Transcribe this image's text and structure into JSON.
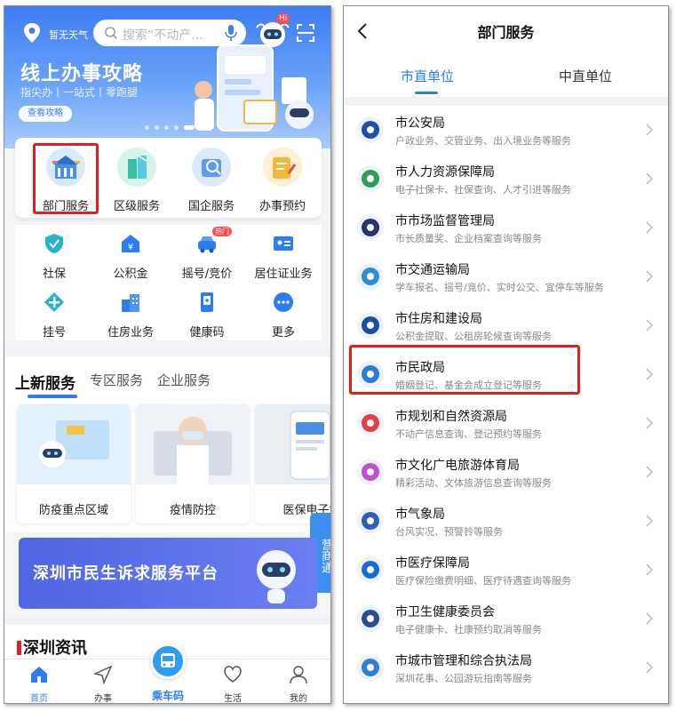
{
  "left": {
    "topbar": {
      "weather": "暂无天气",
      "search_placeholder": "搜索“不动产...",
      "robot_badge": "Hi"
    },
    "banner": {
      "title": "线上办事攻略",
      "subtitle": "指尖办丨一站式丨零跑腿",
      "button": "查看攻略"
    },
    "main_services": [
      {
        "label": "部门服务",
        "icon": "department-icon",
        "color": "#4a90e2"
      },
      {
        "label": "区级服务",
        "icon": "district-icon",
        "color": "#3bbfa6"
      },
      {
        "label": "国企服务",
        "icon": "soe-icon",
        "color": "#5b9cf0"
      },
      {
        "label": "办事预约",
        "icon": "appointment-icon",
        "color": "#f5b63c"
      }
    ],
    "grid": [
      {
        "label": "社保",
        "icon": "shield-icon"
      },
      {
        "label": "公积金",
        "icon": "fund-icon"
      },
      {
        "label": "摇号/竞价",
        "icon": "car-icon",
        "badge": "热门"
      },
      {
        "label": "居住证业务",
        "icon": "id-card-icon"
      },
      {
        "label": "挂号",
        "icon": "plus-icon"
      },
      {
        "label": "住房业务",
        "icon": "building-icon"
      },
      {
        "label": "健康码",
        "icon": "phone-icon"
      },
      {
        "label": "更多",
        "icon": "more-icon"
      }
    ],
    "tabs": [
      "上新服务",
      "专区服务",
      "企业服务"
    ],
    "tiles": [
      "防疫重点区域",
      "疫情防控",
      "医保电子凭"
    ],
    "side_tab": "营商通",
    "promo": "深圳市民生诉求服务平台",
    "news_title": "深圳资讯",
    "nav": [
      "首页",
      "办事",
      "乘车码",
      "生活",
      "我的"
    ]
  },
  "right": {
    "title": "部门服务",
    "tabs": [
      "市直单位",
      "中直单位"
    ],
    "items": [
      {
        "name": "市公安局",
        "desc": "户政业务、交管业务、出入境业务等服务",
        "color": "#1f4fa8"
      },
      {
        "name": "市人力资源保障局",
        "desc": "电子社保卡、社保查询、人才引进等服务",
        "color": "#2e9e5b"
      },
      {
        "name": "市市场监督管理局",
        "desc": "市长质量奖、企业档案查询等服务",
        "color": "#26356e"
      },
      {
        "name": "市交通运输局",
        "desc": "学车报名、摇号/竞价、实时公交、宜停车等服务",
        "color": "#2a8fd6"
      },
      {
        "name": "市住房和建设局",
        "desc": "公积金提取、公租房轮候查询等服务",
        "color": "#1d4fa0"
      },
      {
        "name": "市民政局",
        "desc": "婚姻登记、基金会成立登记等服务",
        "color": "#2d7bd5"
      },
      {
        "name": "市规划和自然资源局",
        "desc": "不动产信息查询、登记预约等服务",
        "color": "#e04040"
      },
      {
        "name": "市文化广电旅游体育局",
        "desc": "精彩活动、文体旅游信息查询等服务",
        "color": "#c24fd0"
      },
      {
        "name": "市气象局",
        "desc": "台风实况、预警铃等服务",
        "color": "#2f5fb8"
      },
      {
        "name": "市医疗保障局",
        "desc": "医疗保险缴费明细、医疗待遇查询等服务",
        "color": "#1a6ad6"
      },
      {
        "name": "市卫生健康委员会",
        "desc": "电子健康卡、社康预约取消等服务",
        "color": "#2a4e8c"
      },
      {
        "name": "市城市管理和综合执法局",
        "desc": "深圳花事、公园游玩指南等服务",
        "color": "#2f7fd8"
      }
    ]
  }
}
